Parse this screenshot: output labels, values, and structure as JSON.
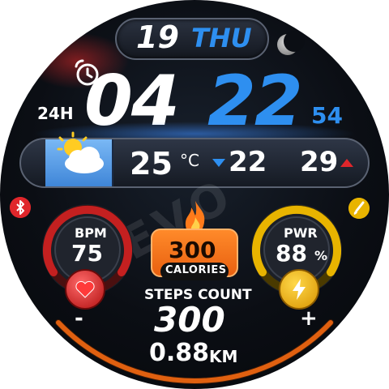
{
  "date": {
    "day": "19",
    "weekday": "THU"
  },
  "time": {
    "format": "24H",
    "hour": "04",
    "minute": "22",
    "second": "54"
  },
  "weather": {
    "icon": "partly-cloudy-icon",
    "temperature": "25",
    "unit": "°C",
    "low": "22",
    "high": "29"
  },
  "heart": {
    "label": "BPM",
    "value": "75"
  },
  "battery": {
    "label": "PWR",
    "value": "88",
    "unit": "%",
    "level": 0.88
  },
  "calories": {
    "value": "300",
    "label": "CALORIES"
  },
  "steps": {
    "title": "STEPS COUNT",
    "value": "300"
  },
  "distance": {
    "value": "0.88",
    "unit": "KM"
  },
  "controls": {
    "minus": "-",
    "plus": "+"
  },
  "watermark": "AEVO",
  "colors": {
    "accent_blue": "#2e8ff0",
    "heart_red": "#e0262b",
    "battery_yellow": "#e8b400",
    "calorie_orange": "#f07a1e"
  }
}
